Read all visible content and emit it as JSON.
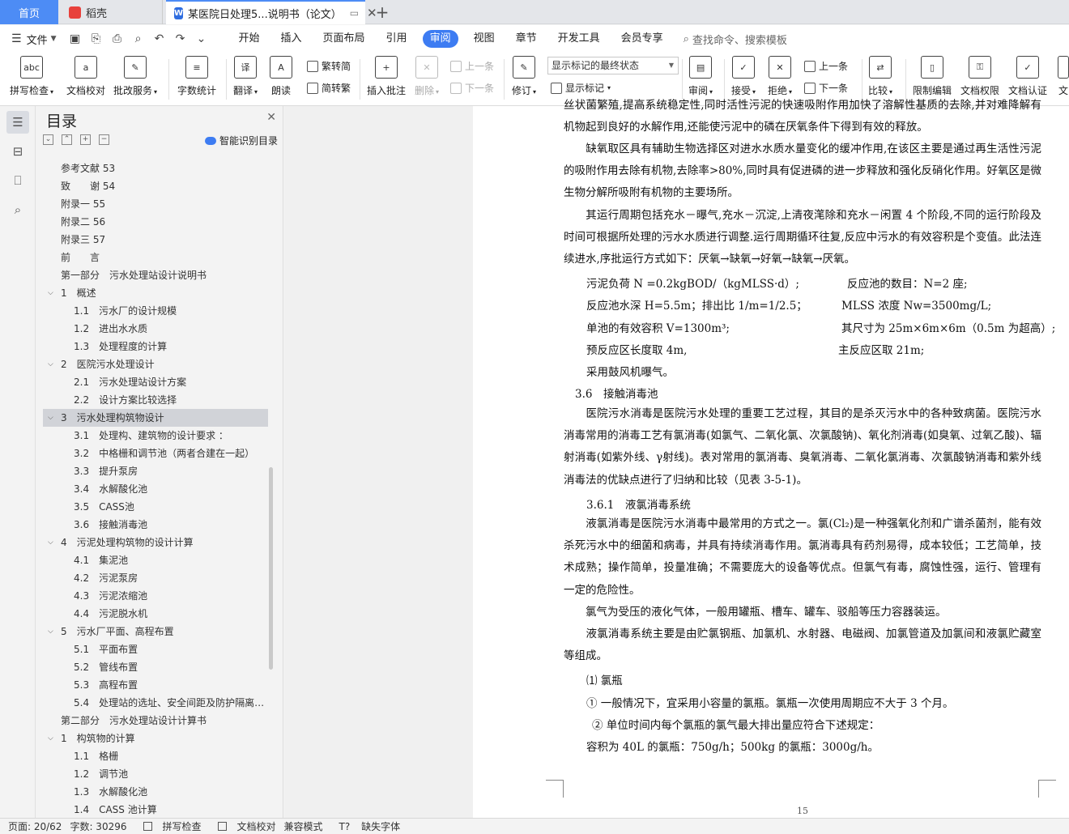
{
  "tabs": {
    "home": "首页",
    "daoke": "稻壳",
    "doc_title": "某医院日处理5...说明书（论文）",
    "add": "+"
  },
  "menu": {
    "file": "文件",
    "items": [
      "开始",
      "插入",
      "页面布局",
      "引用",
      "审阅",
      "视图",
      "章节",
      "开发工具",
      "会员专享"
    ],
    "search": "查找命令、搜索模板"
  },
  "ribbon": {
    "spell": "拼写检查",
    "doccheck": "文档校对",
    "batch": "批改服务",
    "wordcount": "字数统计",
    "translate": "翻译",
    "read": "朗读",
    "trad": "繁转简",
    "simp": "简转繁",
    "insert_comment": "插入批注",
    "delete": "删除",
    "prev": "上一条",
    "next": "下一条",
    "revise": "修订",
    "markup_state": "显示标记的最终状态",
    "show_markup": "显示标记",
    "review": "审阅",
    "accept": "接受",
    "reject": "拒绝",
    "prev2": "上一条",
    "next2": "下一条",
    "compare": "比较",
    "restrict": "限制编辑",
    "perm": "文档权限",
    "cert": "文档认证",
    "more": "文"
  },
  "toc": {
    "title": "目录",
    "smart": "智能识别目录",
    "items": [
      {
        "text": "参考文献 53",
        "level": 1,
        "chev": false
      },
      {
        "text": "致　　谢 54",
        "level": 1,
        "chev": false
      },
      {
        "text": "附录一 55",
        "level": 1,
        "chev": false
      },
      {
        "text": "附录二 56",
        "level": 1,
        "chev": false
      },
      {
        "text": "附录三 57",
        "level": 1,
        "chev": false
      },
      {
        "text": "前　　言",
        "level": 1,
        "chev": false
      },
      {
        "text": "第一部分　污水处理站设计说明书",
        "level": 1,
        "chev": false
      },
      {
        "text": "1　概述",
        "level": 1,
        "chev": true
      },
      {
        "text": "1.1　污水厂的设计规模",
        "level": 2,
        "chev": false
      },
      {
        "text": "1.2　进出水水质",
        "level": 2,
        "chev": false
      },
      {
        "text": "1.3　处理程度的计算",
        "level": 2,
        "chev": false
      },
      {
        "text": "2　医院污水处理设计",
        "level": 1,
        "chev": true
      },
      {
        "text": "2.1　污水处理站设计方案",
        "level": 2,
        "chev": false
      },
      {
        "text": "2.2　设计方案比较选择",
        "level": 2,
        "chev": false
      },
      {
        "text": "3　污水处理构筑物设计",
        "level": 1,
        "chev": true,
        "selected": true
      },
      {
        "text": "3.1　处理构、建筑物的设计要求 ：",
        "level": 2,
        "chev": false
      },
      {
        "text": "3.2　中格栅和调节池（两者合建在一起）",
        "level": 2,
        "chev": false
      },
      {
        "text": "3.3　提升泵房",
        "level": 2,
        "chev": false
      },
      {
        "text": "3.4　水解酸化池",
        "level": 2,
        "chev": false
      },
      {
        "text": "3.5　CASS池",
        "level": 2,
        "chev": false
      },
      {
        "text": "3.6　接触消毒池",
        "level": 2,
        "chev": false
      },
      {
        "text": "4　污泥处理构筑物的设计计算",
        "level": 1,
        "chev": true
      },
      {
        "text": "4.1　集泥池",
        "level": 2,
        "chev": false
      },
      {
        "text": "4.2　污泥泵房",
        "level": 2,
        "chev": false
      },
      {
        "text": "4.3　污泥浓缩池",
        "level": 2,
        "chev": false
      },
      {
        "text": "4.4　污泥脱水机",
        "level": 2,
        "chev": false
      },
      {
        "text": "5　污水厂平面、高程布置",
        "level": 1,
        "chev": true
      },
      {
        "text": "5.1　平面布置",
        "level": 2,
        "chev": false
      },
      {
        "text": "5.2　管线布置",
        "level": 2,
        "chev": false
      },
      {
        "text": "5.3　高程布置",
        "level": 2,
        "chev": false
      },
      {
        "text": "5.4　处理站的选址、安全间距及防护隔离措施",
        "level": 2,
        "chev": false
      },
      {
        "text": "第二部分　污水处理站设计计算书",
        "level": 1,
        "chev": false
      },
      {
        "text": "1　构筑物的计算",
        "level": 1,
        "chev": true
      },
      {
        "text": "1.1　格栅",
        "level": 2,
        "chev": false
      },
      {
        "text": "1.2　调节池",
        "level": 2,
        "chev": false
      },
      {
        "text": "1.3　水解酸化池",
        "level": 2,
        "chev": false
      },
      {
        "text": "1.4　CASS 池计算",
        "level": 2,
        "chev": false
      }
    ]
  },
  "doc": {
    "p0": "丝状菌繁殖,提高系统稳定性,同时活性污泥的快速吸附作用加快了溶解性基质的去除,并对难降解有机物起到良好的水解作用,还能使污泥中的磷在厌氧条件下得到有效的释放。",
    "p1": "　　缺氧取区具有辅助生物选择区对进水水质水量变化的缓冲作用,在该区主要是通过再生活性污泥的吸附作用去除有机物,去除率>80%,同时具有促进磷的进一步释放和强化反硝化作用。好氧区是微生物分解所吸附有机物的主要场所。",
    "p2": "　　其运行周期包括充水－曝气,充水－沉淀,上清夜滗除和充水－闲置 4 个阶段,不同的运行阶段及时间可根据所处理的污水水质进行调整.运行周期循环往复,反应中污水的有效容积是个变值。此法连续进水,序批运行方式如下：厌氧→缺氧→好氧→缺氧→厌氧。",
    "l_a1": "污泥负荷 N =0.2kgBOD/（kgMLSS·d）;",
    "l_a2": "反应池的数目：N=2 座;",
    "l_b1": "反应池水深 H=5.5m；排出比 1/m=1/2.5；",
    "l_b2": "MLSS 浓度 Nw=3500mg/L;",
    "l_c1": "单池的有效容积 V=1300m³;",
    "l_c2": "其尺寸为 25m×6m×6m（0.5m 为超高）;",
    "l_d1": "预反应区长度取 4m,",
    "l_d2": "主反应区取 21m;",
    "l_e": "采用鼓风机曝气。",
    "h36": "3.6　接触消毒池",
    "p3": "　　医院污水消毒是医院污水处理的重要工艺过程，其目的是杀灭污水中的各种致病菌。医院污水消毒常用的消毒工艺有氯消毒(如氯气、二氧化氯、次氯酸钠)、氧化剂消毒(如臭氧、过氧乙酸)、辐射消毒(如紫外线、γ射线)。表对常用的氯消毒、臭氧消毒、二氧化氯消毒、次氯酸钠消毒和紫外线消毒法的优缺点进行了归纳和比较（见表 3-5-1)。",
    "h361": "3.6.1　液氯消毒系统",
    "p4": "　　液氯消毒是医院污水消毒中最常用的方式之一。氯(Cl₂)是一种强氧化剂和广谱杀菌剂，能有效杀死污水中的细菌和病毒，并具有持续消毒作用。氯消毒具有药剂易得，成本较低；工艺简单，技术成熟；操作简单，投量准确；不需要庞大的设备等优点。但氯气有毒，腐蚀性强，运行、管理有一定的危险性。",
    "p5": "　　氯气为受压的液化气体，一般用罐瓶、槽车、罐车、驳船等压力容器装运。",
    "p6": "　　液氯消毒系统主要是由贮氯钢瓶、加氯机、水射器、电磁阀、加氯管道及加氯间和液氯贮藏室等组成。",
    "l_f": "⑴ 氯瓶",
    "l_g": "① 一般情况下，宜采用小容量的氯瓶。氯瓶一次使用周期应不大于 3 个月。",
    "l_h": "② 单位时间内每个氯瓶的氯气最大排出量应符合下述规定：",
    "l_i": "容积为 40L 的氯瓶：750g/h；500kg 的氯瓶：3000g/h。",
    "page_num": "15"
  },
  "status": {
    "page": "页面: 20/62",
    "words": "字数: 30296",
    "spell": "拼写检查",
    "doccheck": "文档校对",
    "compat": "兼容模式",
    "missing_font": "缺失字体"
  }
}
